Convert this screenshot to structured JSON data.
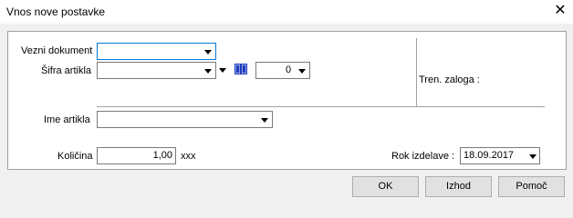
{
  "window": {
    "title": "Vnos nove postavke",
    "close_icon": "close-icon"
  },
  "form": {
    "vezni_dokument": {
      "label": "Vezni dokument",
      "value": ""
    },
    "sifra_artikla": {
      "label": "Šifra artikla",
      "value": "",
      "variant_value": "0"
    },
    "tren_zaloga": {
      "label": "Tren. zaloga :"
    },
    "ime_artikla": {
      "label": "Ime artikla",
      "value": ""
    },
    "kolicina": {
      "label": "Količina",
      "value": "1,00",
      "unit": "xxx"
    },
    "rok_izdelave": {
      "label": "Rok izdelave :",
      "value": "18.09.2017"
    }
  },
  "buttons": {
    "ok": "OK",
    "izhod": "Izhod",
    "pomoc": "Pomoč"
  },
  "colors": {
    "focus_border": "#0078d7",
    "book_icon": "#1f3fbf"
  }
}
